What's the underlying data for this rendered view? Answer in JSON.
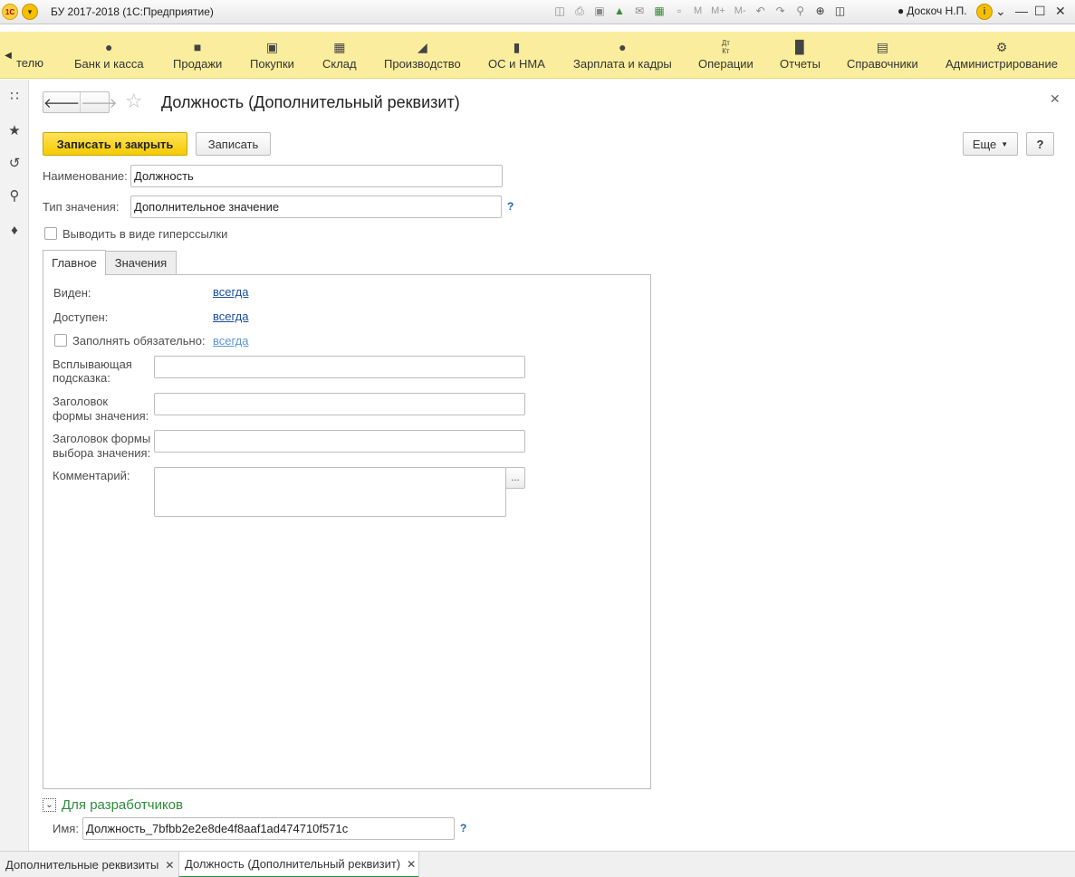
{
  "app": {
    "title": "БУ 2017-2018  (1С:Предприятие)",
    "user": "Доскоч Н.П.",
    "toolbar_text": {
      "m": "M",
      "m_plus": "M+",
      "m_minus": "M-"
    }
  },
  "sections": {
    "cut_label": "телю",
    "items": [
      {
        "label": "Банк и касса",
        "icon": "ruble-icon"
      },
      {
        "label": "Продажи",
        "icon": "bag-icon"
      },
      {
        "label": "Покупки",
        "icon": "cart-icon"
      },
      {
        "label": "Склад",
        "icon": "grid-icon"
      },
      {
        "label": "Производство",
        "icon": "factory-icon"
      },
      {
        "label": "ОС и НМА",
        "icon": "truck-icon"
      },
      {
        "label": "Зарплата и кадры",
        "icon": "person-icon"
      },
      {
        "label": "Операции",
        "icon": "dt-kt-icon"
      },
      {
        "label": "Отчеты",
        "icon": "bar-chart-icon"
      },
      {
        "label": "Справочники",
        "icon": "book-icon"
      },
      {
        "label": "Администрирование",
        "icon": "gear-icon"
      }
    ],
    "dt": "Дт",
    "kt": "Кт"
  },
  "form": {
    "title": "Должность (Дополнительный реквизит)",
    "save_close": "Записать и закрыть",
    "save": "Записать",
    "more": "Еще",
    "help": "?",
    "name_label": "Наименование:",
    "name_value": "Должность",
    "type_label": "Тип значения:",
    "type_value": "Дополнительное значение",
    "hyperlink_label": "Выводить в виде гиперссылки",
    "tabs": [
      "Главное",
      "Значения"
    ],
    "main": {
      "visible_label": "Виден:",
      "visible_value": "всегда",
      "available_label": "Доступен:",
      "available_value": "всегда",
      "required_label": "Заполнять обязательно:",
      "required_value": "всегда",
      "tooltip_label_1": "Всплывающая",
      "tooltip_label_2": "подсказка:",
      "value_form_label_1": "Заголовок",
      "value_form_label_2": "формы значения:",
      "choice_form_label_1": "Заголовок формы",
      "choice_form_label_2": "выбора значения:",
      "comment_label": "Комментарий:",
      "dots": "..."
    },
    "developers": {
      "title": "Для разработчиков",
      "name_label": "Имя:",
      "name_value": "Должность_7bfbb2e2e8de4f8aaf1ad474710f571c"
    }
  },
  "bottom_tabs": [
    {
      "label": "Дополнительные реквизиты"
    },
    {
      "label": "Должность (Дополнительный реквизит)"
    }
  ]
}
